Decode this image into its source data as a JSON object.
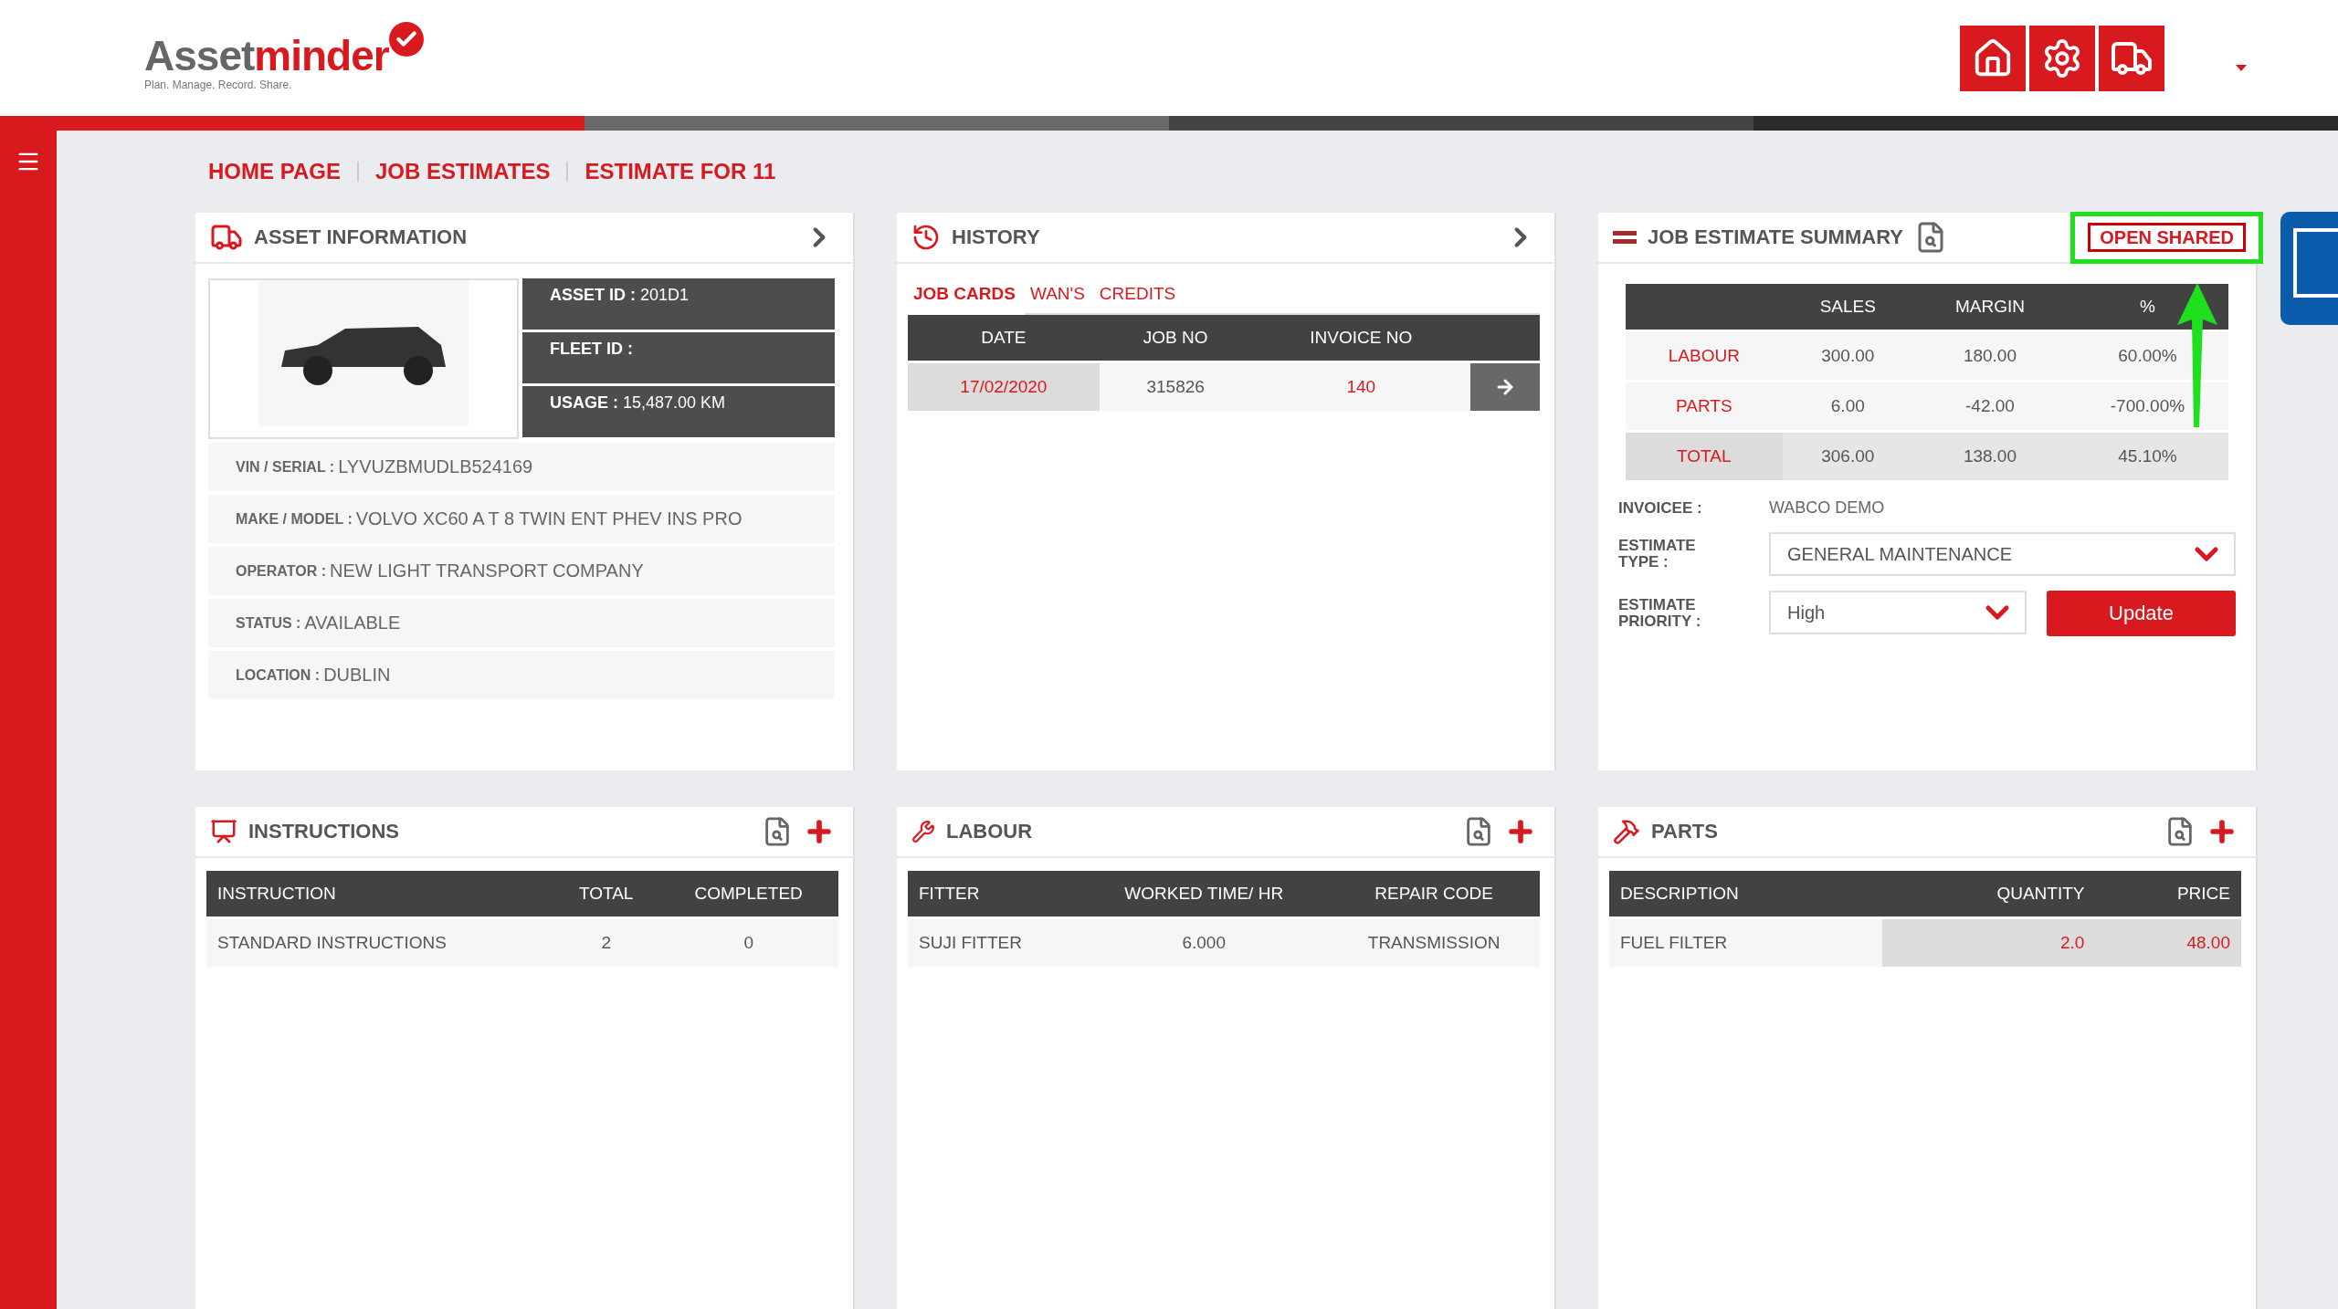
{
  "logo": {
    "dark": "Asset",
    "red": "minder",
    "tagline": "Plan. Manage. Record. Share."
  },
  "breadcrumb": [
    "HOME PAGE",
    "JOB ESTIMATES",
    "ESTIMATE FOR 11"
  ],
  "asset_information": {
    "title": "ASSET INFORMATION",
    "key_facts": [
      {
        "label": "ASSET ID :",
        "value": "201D1"
      },
      {
        "label": "FLEET ID :"
      },
      {
        "label": "USAGE :",
        "value": "15,487.00 KM"
      }
    ],
    "details": [
      {
        "label": "VIN / SERIAL :",
        "value": "LYVUZBMUDLB524169"
      },
      {
        "label": "MAKE / MODEL :",
        "value": "VOLVO XC60 A T 8 TWIN ENT PHEV INS PRO"
      },
      {
        "label": "OPERATOR :",
        "value": "NEW LIGHT TRANSPORT COMPANY"
      },
      {
        "label": "STATUS :",
        "value": "AVAILABLE"
      },
      {
        "label": "LOCATION :",
        "value": "DUBLIN"
      }
    ]
  },
  "history": {
    "title": "HISTORY",
    "tabs": [
      {
        "label": "JOB CARDS",
        "selected": true
      },
      {
        "label": "WAN'S",
        "selected": false
      },
      {
        "label": "CREDITS",
        "selected": false
      }
    ],
    "columns": [
      "DATE",
      "JOB NO",
      "INVOICE NO"
    ],
    "rows": [
      {
        "cells": [
          {
            "text": "17/02/2020",
            "kind": "highlight"
          },
          {
            "text": "315826",
            "kind": "plain"
          },
          {
            "text": "140",
            "kind": "accent"
          }
        ]
      }
    ]
  },
  "summary": {
    "title": "JOB ESTIMATE SUMMARY",
    "status": "OPEN SHARED",
    "columns": [
      "SALES",
      "MARGIN",
      "%"
    ],
    "rows": [
      {
        "label": "LABOUR",
        "kind": "line",
        "values": [
          "300.00",
          "180.00",
          "60.00%"
        ]
      },
      {
        "label": "PARTS",
        "kind": "line",
        "values": [
          "6.00",
          "-42.00",
          "-700.00%"
        ]
      },
      {
        "label": "TOTAL",
        "kind": "total",
        "values": [
          "306.00",
          "138.00",
          "45.10%"
        ]
      }
    ],
    "invoicee": {
      "label": "INVOICEE :",
      "value": "WABCO DEMO"
    },
    "estimate_type": {
      "label": "ESTIMATE TYPE :",
      "value": "GENERAL MAINTENANCE"
    },
    "estimate_priority": {
      "label": "ESTIMATE PRIORITY :",
      "value": "High"
    },
    "update_button": "Update"
  },
  "lists": [
    {
      "kind": "instructions",
      "title": "INSTRUCTIONS",
      "columns": [
        "INSTRUCTION",
        "TOTAL",
        "COMPLETED"
      ],
      "rows": [
        {
          "cells": [
            {
              "text": "STANDARD INSTRUCTIONS",
              "kind": "plain"
            },
            {
              "text": "2",
              "kind": "plain"
            },
            {
              "text": "0",
              "kind": "plain"
            }
          ]
        }
      ]
    },
    {
      "kind": "labour",
      "title": "LABOUR",
      "columns": [
        "FITTER",
        "WORKED TIME/ HR",
        "REPAIR CODE"
      ],
      "rows": [
        {
          "cells": [
            {
              "text": "SUJI FITTER",
              "kind": "plain"
            },
            {
              "text": "6.000",
              "kind": "plain"
            },
            {
              "text": "TRANSMISSION",
              "kind": "plain"
            }
          ]
        }
      ]
    },
    {
      "kind": "parts",
      "title": "PARTS",
      "columns": [
        "DESCRIPTION",
        "QUANTITY",
        "PRICE"
      ],
      "rows": [
        {
          "cells": [
            {
              "text": "FUEL FILTER",
              "kind": "plain"
            },
            {
              "text": "2.0",
              "kind": "highlight"
            },
            {
              "text": "48.00",
              "kind": "highlight"
            }
          ]
        }
      ]
    }
  ]
}
